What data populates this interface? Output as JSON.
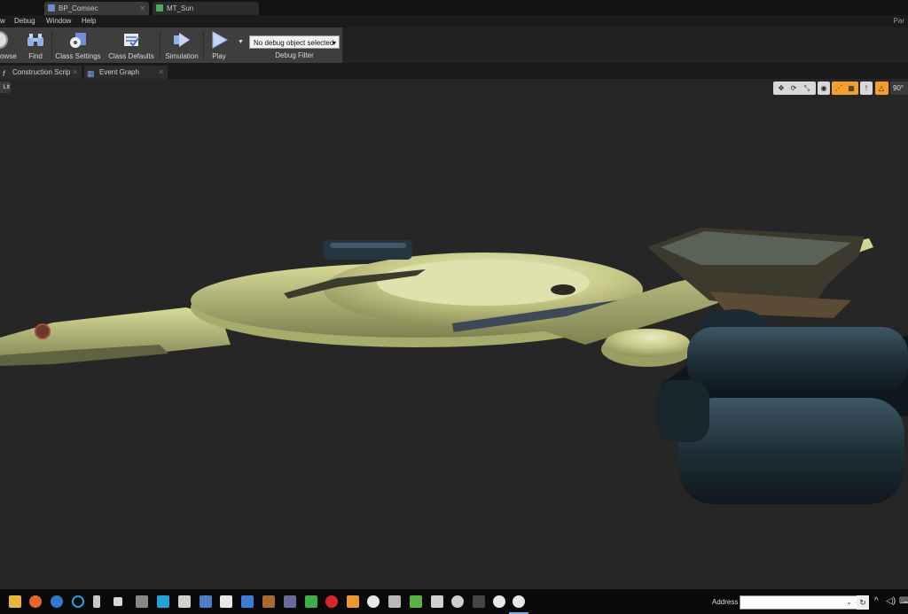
{
  "document_tabs": [
    {
      "label": "BP_Comsec",
      "icon_color": "#6a8cc8"
    },
    {
      "label": "MT_Sun",
      "icon_color": "#4caa5a"
    }
  ],
  "menu": {
    "items": [
      "w",
      "Debug",
      "Window",
      "Help"
    ],
    "right_text": "Par"
  },
  "toolbar": {
    "buttons": [
      {
        "label": "owse",
        "icon": "browse-icon"
      },
      {
        "label": "Find",
        "icon": "binoculars-icon"
      },
      {
        "label": "Class Settings",
        "icon": "gear-icon"
      },
      {
        "label": "Class Defaults",
        "icon": "checklist-icon"
      },
      {
        "label": "Simulation",
        "icon": "simulation-icon"
      },
      {
        "label": "Play",
        "icon": "play-icon"
      }
    ],
    "debug_select_value": "No debug object selected",
    "debug_filter_label": "Debug Filter"
  },
  "graph_tabs": [
    {
      "label": "Construction Scrip",
      "icon": "function-icon"
    },
    {
      "label": "Event Graph",
      "icon": "event-graph-icon"
    }
  ],
  "viewport": {
    "view_mode_label": "Lit",
    "camera_fov": "90°"
  },
  "taskbar": {
    "address_label": "Address",
    "address_value": ""
  }
}
